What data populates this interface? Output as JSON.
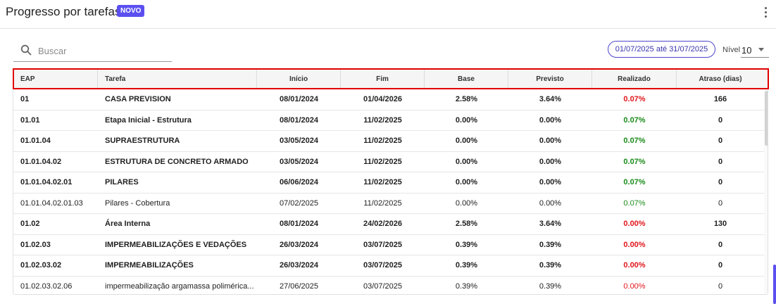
{
  "header": {
    "title": "Progresso por tarefas",
    "badge": "NOVO",
    "menu_icon": "more-vertical-icon"
  },
  "toolbar": {
    "search_placeholder": "Buscar",
    "search_value": "",
    "search_icon": "search-icon",
    "date_range": "01/07/2025 até 31/07/2025",
    "nivel_label": "Nível",
    "nivel_value": "10"
  },
  "table": {
    "columns": [
      "EAP",
      "Tarefa",
      "Início",
      "Fim",
      "Base",
      "Previsto",
      "Realizado",
      "Atraso (dias)"
    ],
    "rows": [
      {
        "eap": "01",
        "tarefa": "CASA PREVISION",
        "inicio": "08/01/2024",
        "fim": "01/04/2026",
        "base": "2.58%",
        "previsto": "3.64%",
        "realizado": "0.07%",
        "realizado_status": "red",
        "atraso": "166",
        "bold": true
      },
      {
        "eap": "01.01",
        "tarefa": "Etapa Inicial - Estrutura",
        "inicio": "08/01/2024",
        "fim": "11/02/2025",
        "base": "0.00%",
        "previsto": "0.00%",
        "realizado": "0.07%",
        "realizado_status": "green",
        "atraso": "0",
        "bold": true
      },
      {
        "eap": "01.01.04",
        "tarefa": "SUPRAESTRUTURA",
        "inicio": "03/05/2024",
        "fim": "11/02/2025",
        "base": "0.00%",
        "previsto": "0.00%",
        "realizado": "0.07%",
        "realizado_status": "green",
        "atraso": "0",
        "bold": true
      },
      {
        "eap": "01.01.04.02",
        "tarefa": "ESTRUTURA DE CONCRETO ARMADO",
        "inicio": "03/05/2024",
        "fim": "11/02/2025",
        "base": "0.00%",
        "previsto": "0.00%",
        "realizado": "0.07%",
        "realizado_status": "green",
        "atraso": "0",
        "bold": true
      },
      {
        "eap": "01.01.04.02.01",
        "tarefa": "PILARES",
        "inicio": "06/06/2024",
        "fim": "11/02/2025",
        "base": "0.00%",
        "previsto": "0.00%",
        "realizado": "0.07%",
        "realizado_status": "green",
        "atraso": "0",
        "bold": true
      },
      {
        "eap": "01.01.04.02.01.03",
        "tarefa": "Pilares - Cobertura",
        "inicio": "07/02/2025",
        "fim": "11/02/2025",
        "base": "0.00%",
        "previsto": "0.00%",
        "realizado": "0.07%",
        "realizado_status": "green",
        "atraso": "0",
        "bold": false
      },
      {
        "eap": "01.02",
        "tarefa": "Área Interna",
        "inicio": "08/01/2024",
        "fim": "24/02/2026",
        "base": "2.58%",
        "previsto": "3.64%",
        "realizado": "0.00%",
        "realizado_status": "red",
        "atraso": "130",
        "bold": true
      },
      {
        "eap": "01.02.03",
        "tarefa": "IMPERMEABILIZAÇÕES E VEDAÇÕES",
        "inicio": "26/03/2024",
        "fim": "03/07/2025",
        "base": "0.39%",
        "previsto": "0.39%",
        "realizado": "0.00%",
        "realizado_status": "red",
        "atraso": "0",
        "bold": true
      },
      {
        "eap": "01.02.03.02",
        "tarefa": "IMPERMEABILIZAÇÕES",
        "inicio": "26/03/2024",
        "fim": "03/07/2025",
        "base": "0.39%",
        "previsto": "0.39%",
        "realizado": "0.00%",
        "realizado_status": "red",
        "atraso": "0",
        "bold": true
      },
      {
        "eap": "01.02.03.02.06",
        "tarefa": "impermeabilização argamassa poliméricа...",
        "inicio": "27/06/2025",
        "fim": "03/07/2025",
        "base": "0.39%",
        "previsto": "0.39%",
        "realizado": "0.00%",
        "realizado_status": "red",
        "atraso": "0",
        "bold": false
      }
    ]
  },
  "colors": {
    "accent": "#5b4ff0",
    "green": "#1a8a1a",
    "red": "#e0151b",
    "highlight": "#e00000"
  }
}
